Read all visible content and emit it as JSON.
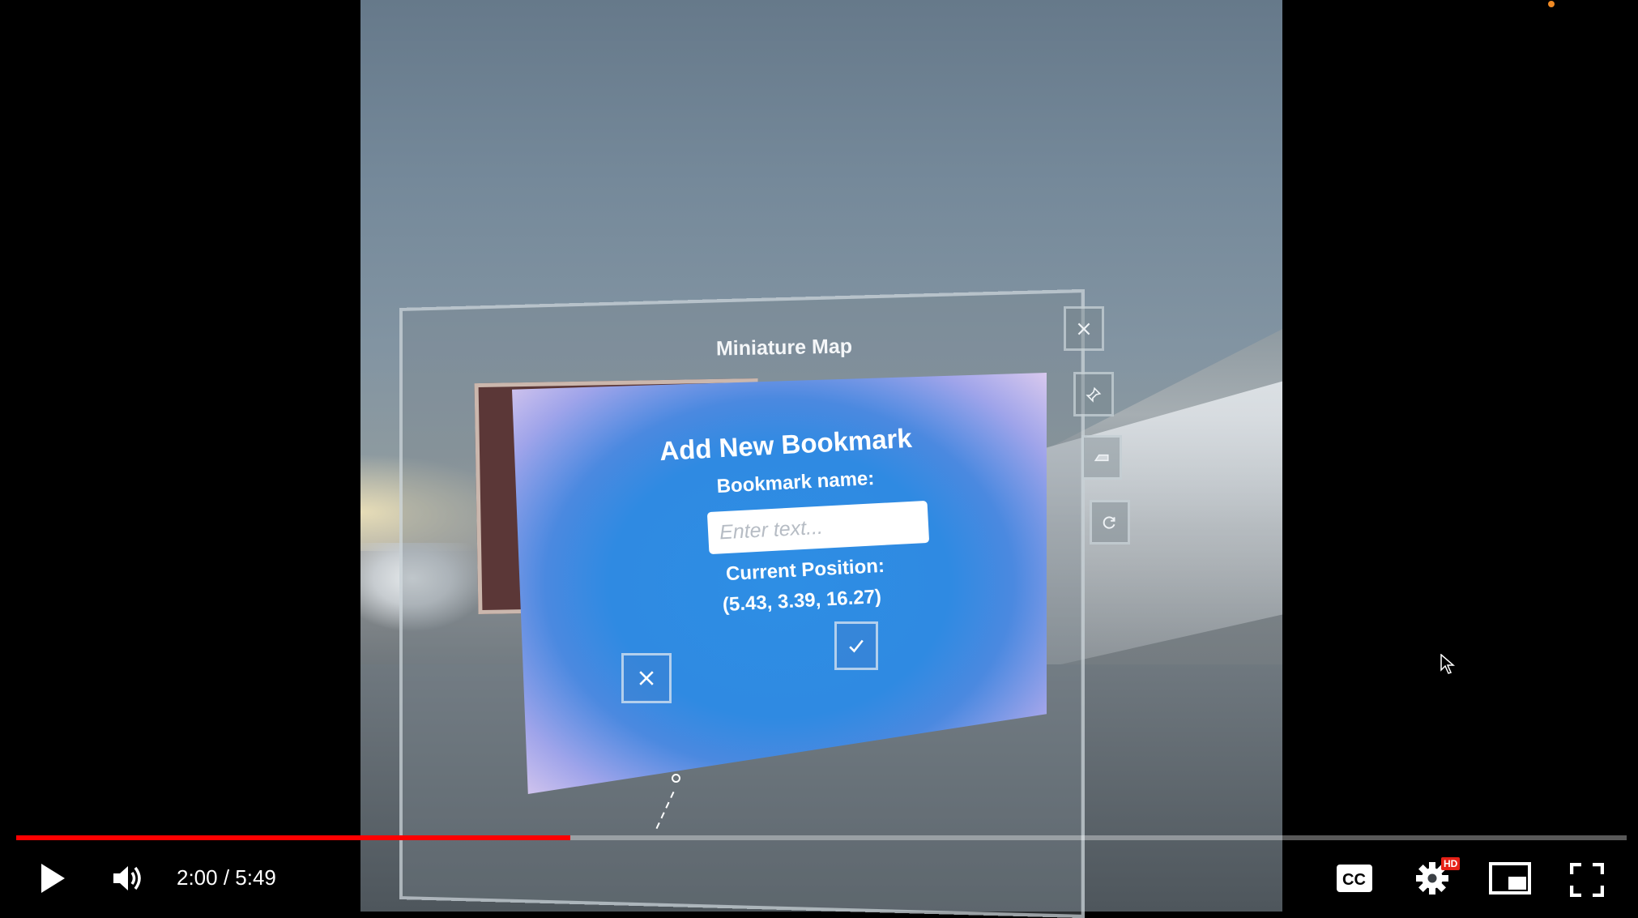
{
  "video": {
    "miniature_map": {
      "title": "Miniature Map"
    },
    "dialog": {
      "title": "Add New Bookmark",
      "name_label": "Bookmark name:",
      "name_placeholder": "Enter text...",
      "name_value": "",
      "position_label": "Current Position:",
      "position_value": "(5.43, 3.39, 16.27)"
    },
    "side_buttons": [
      {
        "icon": "close-icon"
      },
      {
        "icon": "pin-icon"
      },
      {
        "icon": "map-icon"
      },
      {
        "icon": "refresh-icon"
      }
    ]
  },
  "player": {
    "progress_fraction": 0.3441,
    "current_time": "2:00",
    "separator": " / ",
    "duration": "5:49",
    "time_display": "2:00 / 5:49",
    "hd_badge": "HD",
    "accent_color": "#ff0000"
  }
}
